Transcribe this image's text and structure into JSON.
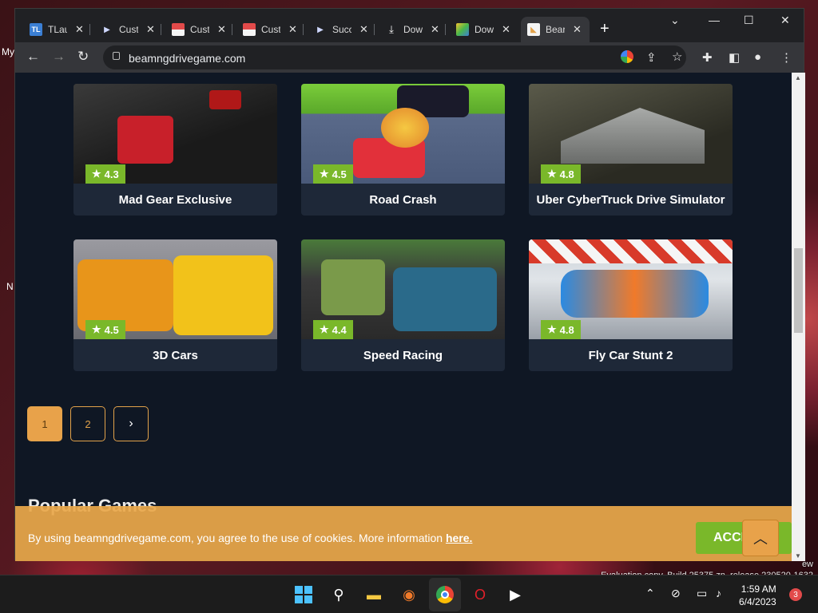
{
  "desktop": {
    "left_labels": [
      "My",
      "N"
    ],
    "watermark": [
      "Evaluation copy. Build 25375.zn_release.230520-1632"
    ],
    "corner_text": "ew"
  },
  "browser": {
    "tabs": [
      {
        "title": "TLau",
        "icon": "tl-favicon",
        "favicon_text": "TL",
        "color": "#3b7fd4"
      },
      {
        "title": "Cust",
        "icon": "play-favicon"
      },
      {
        "title": "Cust",
        "icon": "store-favicon"
      },
      {
        "title": "Cust",
        "icon": "store-favicon"
      },
      {
        "title": "Succ",
        "icon": "play-favicon"
      },
      {
        "title": "Dow",
        "icon": "download-icon"
      },
      {
        "title": "Dow",
        "icon": "bluestacks-favicon"
      },
      {
        "title": "Bear",
        "icon": "beamng-favicon",
        "active": true
      }
    ],
    "url": "beamngdrivegame.com"
  },
  "page": {
    "cards": [
      {
        "title": "Mad Gear Exclusive",
        "rating": "4.3"
      },
      {
        "title": "Road Crash",
        "rating": "4.5"
      },
      {
        "title": "Uber CyberTruck Drive Simulator",
        "rating": "4.8"
      },
      {
        "title": "3D Cars",
        "rating": "4.5"
      },
      {
        "title": "Speed Racing",
        "rating": "4.4"
      },
      {
        "title": "Fly Car Stunt 2",
        "rating": "4.8"
      }
    ],
    "pagination": {
      "pages": [
        "1",
        "2"
      ],
      "next": "›",
      "current": "1"
    },
    "section_title": "Popular Games",
    "cookie": {
      "text": "By using beamngdrivegame.com, you agree to the use of cookies. More information ",
      "link": "here.",
      "accept_label": "ACCI"
    }
  },
  "taskbar": {
    "time": "1:59 AM",
    "date": "6/4/2023",
    "notifications": "3"
  }
}
